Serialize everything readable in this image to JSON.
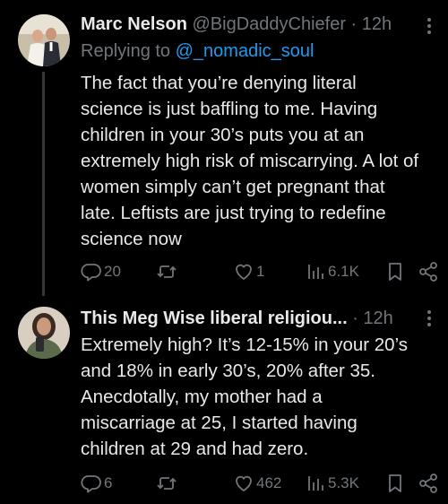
{
  "tweets": [
    {
      "display_name": "Marc Nelson",
      "handle": "@BigDaddyChiefer",
      "separator": " · ",
      "time": "12h",
      "replying_prefix": "Replying to ",
      "replying_to": "@_nomadic_soul",
      "body_lines": [
        "The fact that you’re denying literal",
        "science is just baffling to me. Having",
        "children in your 30’s puts you at an",
        "extremely high risk of miscarrying. A lot of",
        "women simply can’t get pregnant that",
        "late. Leftists are just trying to redefine",
        "science now"
      ],
      "replies": "20",
      "retweets": "",
      "likes": "1",
      "views": "6.1K",
      "icons": [
        "reply-icon",
        "retweet-icon",
        "like-icon",
        "views-icon",
        "bookmark-icon",
        "share-icon",
        "more-icon"
      ]
    },
    {
      "display_name": "This Meg Wise liberal religiou...",
      "handle": "",
      "separator": " · ",
      "time": "12h",
      "body_lines": [
        "Extremely high? It’s 12-15% in your 20’s",
        "and 18% in early 30’s, 20% after 35.",
        "Anecdotally, my mother had a",
        "miscarriage at 25, I started having",
        "children at 29 and had zero."
      ],
      "replies": "6",
      "retweets": "",
      "likes": "462",
      "views": "5.3K",
      "icons": [
        "reply-icon",
        "retweet-icon",
        "like-icon",
        "views-icon",
        "bookmark-icon",
        "share-icon",
        "more-icon"
      ]
    }
  ],
  "colors": {
    "background": "#000000",
    "text_primary": "#e7e9ea",
    "text_secondary": "#71767b",
    "mention": "#1d9bf0",
    "thread_line": "#333639"
  }
}
